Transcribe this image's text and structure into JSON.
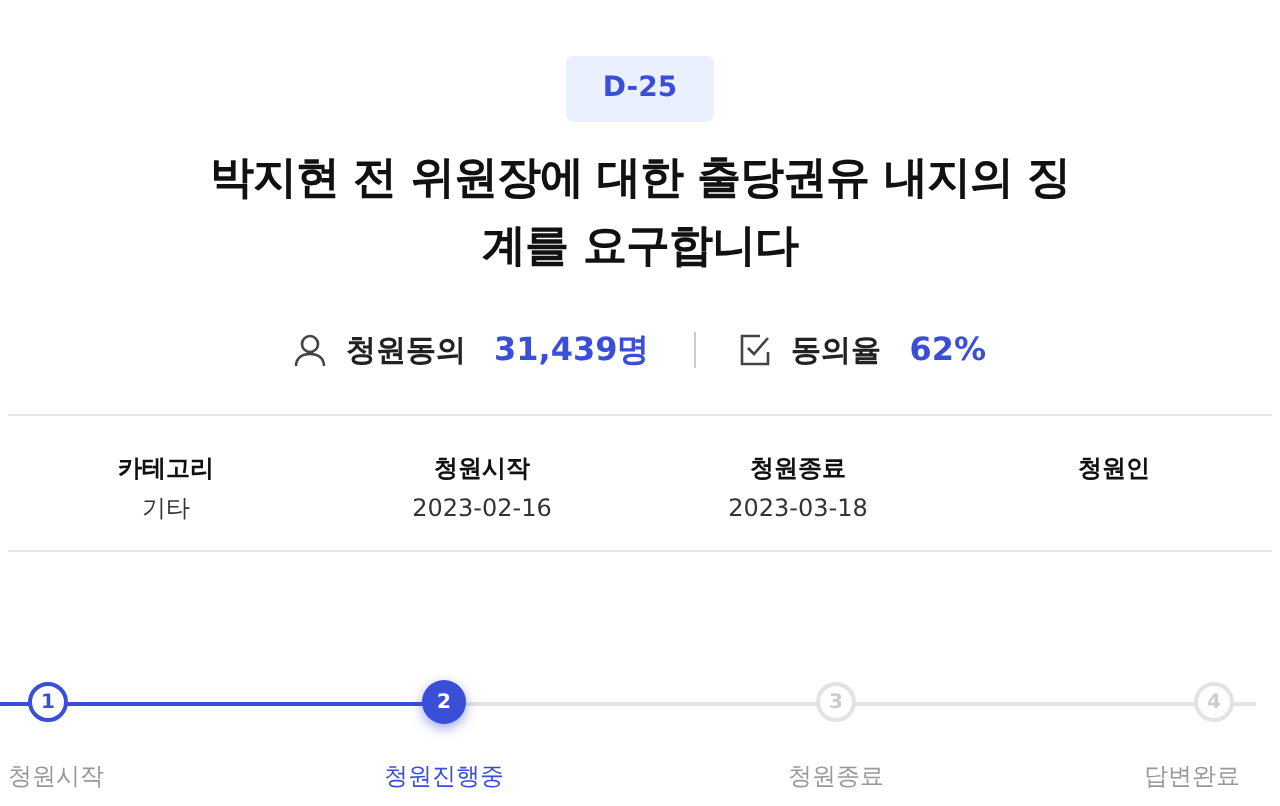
{
  "badge": "D-25",
  "title": "박지현 전 위원장에 대한 출당권유 내지의 징계를 요구합니다",
  "stats": [
    {
      "kind": "person",
      "label": "청원동의",
      "value": "31,439명"
    },
    {
      "kind": "check",
      "label": "동의율",
      "value": "62%"
    }
  ],
  "info": [
    {
      "label": "카테고리",
      "value": "기타"
    },
    {
      "label": "청원시작",
      "value": "2023-02-16"
    },
    {
      "label": "청원종료",
      "value": "2023-03-18"
    },
    {
      "label": "청원인"
    }
  ],
  "steps": [
    {
      "number": "1",
      "label": "청원시작",
      "done": true,
      "selected": false
    },
    {
      "number": "2",
      "label": "청원진행중",
      "done": true,
      "selected": true
    },
    {
      "number": "3",
      "label": "청원종료",
      "done": false,
      "selected": false
    },
    {
      "number": "4",
      "label": "답변완료",
      "done": false,
      "selected": false
    }
  ]
}
